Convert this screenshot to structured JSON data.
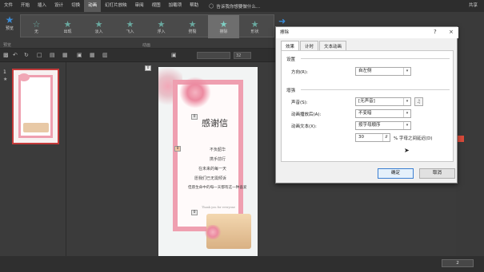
{
  "menubar": {
    "items": [
      "文件",
      "开始",
      "插入",
      "设计",
      "切换",
      "动画",
      "幻灯片放映",
      "审阅",
      "视图",
      "加载项",
      "帮助"
    ],
    "active_index": 5,
    "tell_me": "告诉我你想要做什么...",
    "share": "共享"
  },
  "ribbon": {
    "preview_label": "预览",
    "preview_group": "预览",
    "animations": [
      "无",
      "出现",
      "淡入",
      "飞入",
      "浮入",
      "劈裂",
      "擦除",
      "形状"
    ],
    "selected_animation": "擦除",
    "group_label": "动画"
  },
  "toolbar2": {
    "zoom_value": "32"
  },
  "thumbnail": {
    "number": "1",
    "star": "★"
  },
  "slide": {
    "title": "感谢信",
    "lines": [
      "不负韶华",
      "携手前行",
      "在未来的每一天",
      "愿我们已无需倾诉",
      "但愿生命中的每一天都有这一种喜爱"
    ],
    "footnote": "Thank you for everyone",
    "markers": [
      "0",
      "0",
      "0",
      "0"
    ]
  },
  "dialog": {
    "title": "擦除",
    "help": "?",
    "close": "×",
    "tabs": [
      "效果",
      "计时",
      "文本动画"
    ],
    "section_settings": "设置",
    "direction_label": "方向(R):",
    "direction_value": "自左侧",
    "section_enhance": "增强",
    "sound_label": "声音(S):",
    "sound_value": "[无声音]",
    "after_label": "动画播放后(A):",
    "after_value": "不变暗",
    "text_label": "动画文本(X):",
    "text_value": "按字母顺序",
    "delay_value": "30",
    "delay_suffix": "% 字母之间延迟(D)",
    "ok": "确定",
    "cancel": "取消"
  },
  "statusbar": {
    "left": "",
    "zoom": "2"
  },
  "colors": {
    "accent": "#c43a3a",
    "frame_pink": "#ef9fb0"
  }
}
